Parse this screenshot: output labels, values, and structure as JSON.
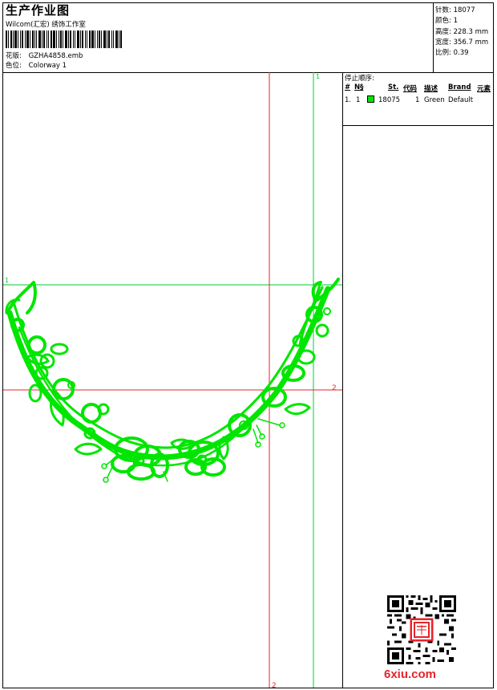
{
  "header": {
    "title": "生产作业图",
    "company": "Wilcom(汇宏) 绣饰工作室",
    "design_label": "花版:",
    "design_value": "GZHA4858.emb",
    "color_label": "色位:",
    "color_value": "Colorway 1"
  },
  "stats": [
    {
      "label": "针数:",
      "value": "18077"
    },
    {
      "label": "颜色:",
      "value": "1"
    },
    {
      "label": "高度:",
      "value": "228.3 mm"
    },
    {
      "label": "宽度:",
      "value": "356.7 mm"
    },
    {
      "label": "比例:",
      "value": "0.39"
    }
  ],
  "sequence": {
    "title": "停止顺序:",
    "headers": {
      "hash": "#",
      "no": "N§",
      "st": "St.",
      "code": "代码",
      "desc": "描述",
      "brand": "Brand",
      "elem": "元素"
    },
    "rows": [
      {
        "hash": "1.",
        "no": "1",
        "st": "18075",
        "code": "1",
        "desc": "Green",
        "brand": "Default",
        "color": "#00e600"
      }
    ]
  },
  "guides": {
    "red_label": "2",
    "green_label": "1"
  },
  "colors": {
    "thread": "#00e600",
    "red_guide": "#e8232a",
    "green_guide": "#00cc33"
  },
  "watermark": {
    "brand": "6xiu.com"
  }
}
